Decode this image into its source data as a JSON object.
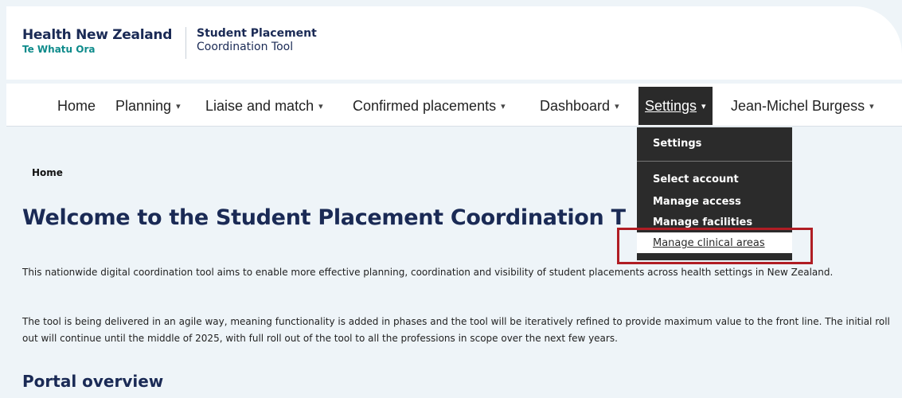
{
  "header": {
    "brand_name": "Health New Zealand",
    "brand_sub": "Te Whatu Ora",
    "tool_line1": "Student Placement",
    "tool_line2": "Coordination Tool"
  },
  "nav": {
    "items": [
      {
        "label": "Home",
        "has_menu": false
      },
      {
        "label": "Planning",
        "has_menu": true
      },
      {
        "label": "Liaise and match",
        "has_menu": true
      },
      {
        "label": "Confirmed placements",
        "has_menu": true
      },
      {
        "label": "Dashboard",
        "has_menu": true
      },
      {
        "label": "Settings",
        "has_menu": true,
        "active": true
      },
      {
        "label": "Jean-Michel Burgess",
        "has_menu": true
      }
    ],
    "caret": "▾"
  },
  "settings_menu": {
    "title": "Settings",
    "items": [
      "Select account",
      "Manage access",
      "Manage facilities"
    ],
    "highlighted": "Manage clinical areas"
  },
  "breadcrumb": "Home",
  "page_title": "Welcome to the Student Placement Coordination T",
  "intro": {
    "p1": "This nationwide digital coordination tool aims to enable more effective planning, coordination and visibility of student placements across health settings in New Zealand.",
    "p2": "The tool is being delivered in an agile way, meaning functionality is added in phases and the tool will be iteratively refined to provide maximum value to the front line. The initial roll out will continue until the middle of 2025, with full roll out of the tool to all the professions in scope over the next few years."
  },
  "section_title": "Portal overview",
  "colors": {
    "brand": "#1a2a55",
    "accent": "#0e8b8b",
    "menu_bg": "#2b2b2b",
    "highlight_box": "#b01d24"
  }
}
